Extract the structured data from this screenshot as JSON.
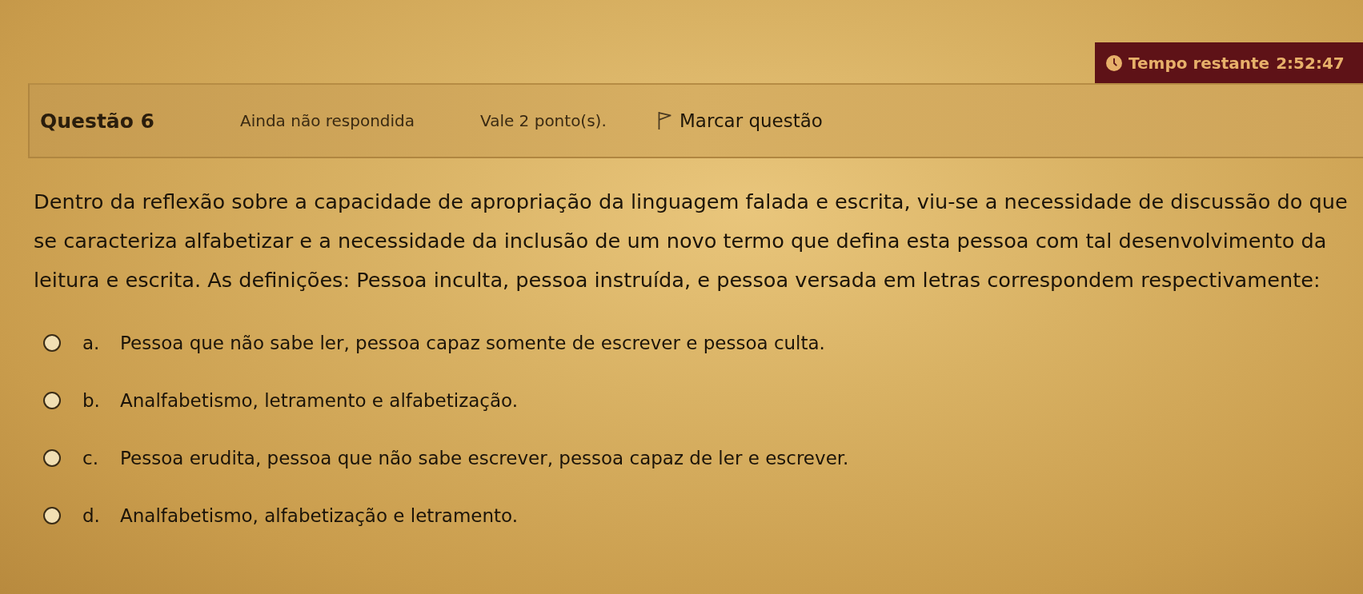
{
  "timer": {
    "label": "Tempo restante",
    "time": "2:52:47"
  },
  "question": {
    "title": "Questão 6",
    "status": "Ainda não respondida",
    "points": "Vale 2 ponto(s).",
    "flag_label": "Marcar questão"
  },
  "prompt": "Dentro da reflexão sobre a capacidade de apropriação da linguagem falada e escrita, viu-se a necessidade de discussão do que se caracteriza alfabetizar e a necessidade da inclusão de um novo termo que defina esta pessoa com tal desenvolvimento da leitura e escrita. As definições: Pessoa inculta, pessoa instruída, e pessoa versada em letras correspondem respectivamente:",
  "options": [
    {
      "letter": "a.",
      "text": "Pessoa que não sabe ler, pessoa capaz somente de escrever e pessoa culta.",
      "selected": false
    },
    {
      "letter": "b.",
      "text": "Analfabetismo, letramento e alfabetização.",
      "selected": false
    },
    {
      "letter": "c.",
      "text": "Pessoa erudita, pessoa que não sabe escrever, pessoa capaz de ler e escrever.",
      "selected": false
    },
    {
      "letter": "d.",
      "text": "Analfabetismo, alfabetização e letramento.",
      "selected": false
    }
  ]
}
